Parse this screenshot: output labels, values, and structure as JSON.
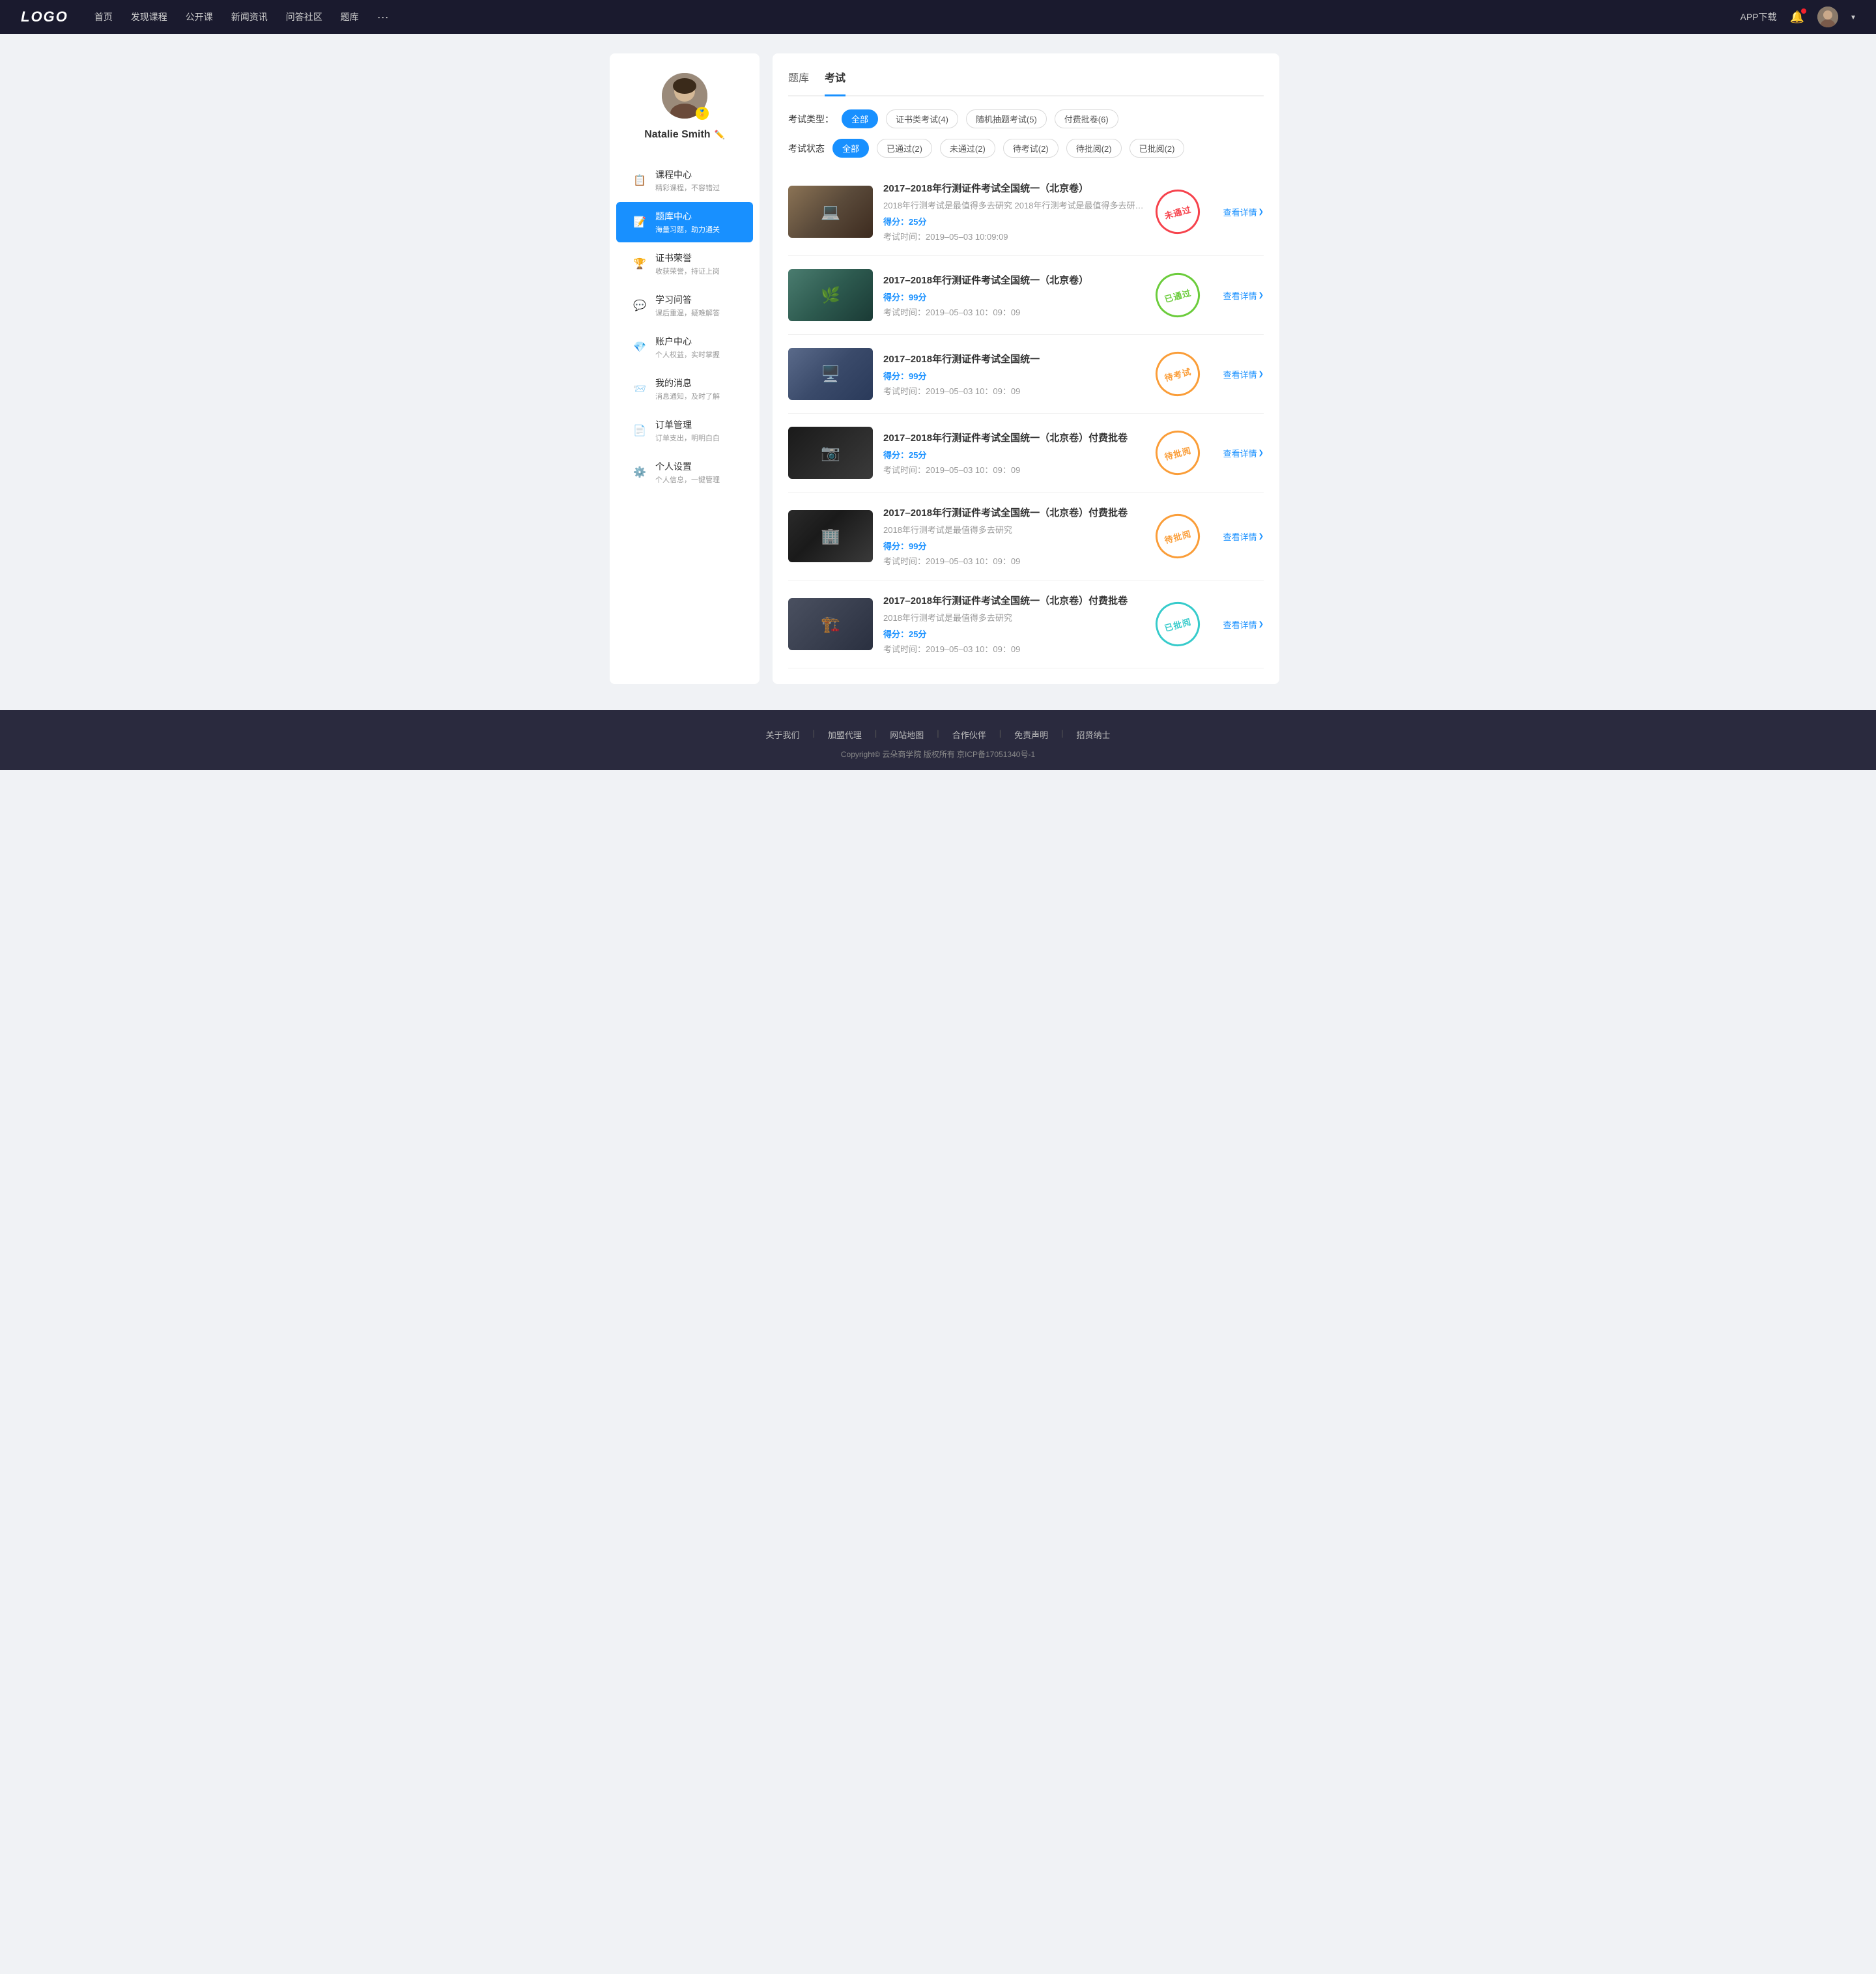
{
  "navbar": {
    "logo": "LOGO",
    "links": [
      "首页",
      "发现课程",
      "公开课",
      "新闻资讯",
      "问答社区",
      "题库"
    ],
    "more": "···",
    "app_download": "APP下载",
    "user_name": "Natalie Smith"
  },
  "sidebar": {
    "profile": {
      "name": "Natalie Smith",
      "badge": "🏅"
    },
    "menu": [
      {
        "id": "course-center",
        "icon": "📋",
        "label": "课程中心",
        "sub": "精彩课程，不容错过",
        "active": false
      },
      {
        "id": "question-bank",
        "icon": "📝",
        "label": "题库中心",
        "sub": "海量习题，助力通关",
        "active": true
      },
      {
        "id": "certificates",
        "icon": "🏆",
        "label": "证书荣誉",
        "sub": "收获荣誉，持证上岗",
        "active": false
      },
      {
        "id": "qa",
        "icon": "💬",
        "label": "学习问答",
        "sub": "课后重温，疑难解答",
        "active": false
      },
      {
        "id": "account",
        "icon": "💎",
        "label": "账户中心",
        "sub": "个人权益，实时掌握",
        "active": false
      },
      {
        "id": "messages",
        "icon": "📨",
        "label": "我的消息",
        "sub": "消息通知，及时了解",
        "active": false
      },
      {
        "id": "orders",
        "icon": "📄",
        "label": "订单管理",
        "sub": "订单支出，明明白白",
        "active": false
      },
      {
        "id": "settings",
        "icon": "⚙️",
        "label": "个人设置",
        "sub": "个人信息，一键管理",
        "active": false
      }
    ]
  },
  "content": {
    "tabs": [
      {
        "id": "question-bank-tab",
        "label": "题库",
        "active": false
      },
      {
        "id": "exam-tab",
        "label": "考试",
        "active": true
      }
    ],
    "filter_type": {
      "label": "考试类型：",
      "options": [
        {
          "label": "全部",
          "active": true
        },
        {
          "label": "证书类考试(4)",
          "active": false
        },
        {
          "label": "随机抽题考试(5)",
          "active": false
        },
        {
          "label": "付费批卷(6)",
          "active": false
        }
      ]
    },
    "filter_status": {
      "label": "考试状态",
      "options": [
        {
          "label": "全部",
          "active": true
        },
        {
          "label": "已通过(2)",
          "active": false
        },
        {
          "label": "未通过(2)",
          "active": false
        },
        {
          "label": "待考试(2)",
          "active": false
        },
        {
          "label": "待批阅(2)",
          "active": false
        },
        {
          "label": "已批阅(2)",
          "active": false
        }
      ]
    },
    "exams": [
      {
        "id": "exam-1",
        "title": "2017–2018年行测证件考试全国统一（北京卷）",
        "desc": "2018年行测考试是最值得多去研究 2018年行测考试是最值得多去研究 2018年行...",
        "score_label": "得分：",
        "score": "25",
        "score_unit": "分",
        "time_label": "考试时间：",
        "time": "2019–05–03  10:09:09",
        "status": "未通过",
        "status_type": "red",
        "thumb_class": "thumb-1",
        "detail_label": "查看详情"
      },
      {
        "id": "exam-2",
        "title": "2017–2018年行测证件考试全国统一（北京卷）",
        "desc": "",
        "score_label": "得分：",
        "score": "99",
        "score_unit": "分",
        "time_label": "考试时间：",
        "time": "2019–05–03  10：09：09",
        "status": "已通过",
        "status_type": "green",
        "thumb_class": "thumb-2",
        "detail_label": "查看详情"
      },
      {
        "id": "exam-3",
        "title": "2017–2018年行测证件考试全国统一",
        "desc": "",
        "score_label": "得分：",
        "score": "99",
        "score_unit": "分",
        "time_label": "考试时间：",
        "time": "2019–05–03  10：09：09",
        "status": "待考试",
        "status_type": "orange",
        "thumb_class": "thumb-3",
        "detail_label": "查看详情"
      },
      {
        "id": "exam-4",
        "title": "2017–2018年行测证件考试全国统一（北京卷）付费批卷",
        "desc": "",
        "score_label": "得分：",
        "score": "25",
        "score_unit": "分",
        "time_label": "考试时间：",
        "time": "2019–05–03  10：09：09",
        "status": "待批阅",
        "status_type": "orange",
        "thumb_class": "thumb-4",
        "detail_label": "查看详情"
      },
      {
        "id": "exam-5",
        "title": "2017–2018年行测证件考试全国统一（北京卷）付费批卷",
        "desc": "2018年行测考试是最值得多去研究",
        "score_label": "得分：",
        "score": "99",
        "score_unit": "分",
        "time_label": "考试时间：",
        "time": "2019–05–03  10：09：09",
        "status": "待批阅",
        "status_type": "orange",
        "thumb_class": "thumb-5",
        "detail_label": "查看详情"
      },
      {
        "id": "exam-6",
        "title": "2017–2018年行测证件考试全国统一（北京卷）付费批卷",
        "desc": "2018年行测考试是最值得多去研究",
        "score_label": "得分：",
        "score": "25",
        "score_unit": "分",
        "time_label": "考试时间：",
        "time": "2019–05–03  10：09：09",
        "status": "已批阅",
        "status_type": "teal",
        "thumb_class": "thumb-6",
        "detail_label": "查看详情"
      }
    ]
  },
  "footer": {
    "links": [
      "关于我们",
      "加盟代理",
      "网站地图",
      "合作伙伴",
      "免责声明",
      "招贤纳士"
    ],
    "copyright": "Copyright© 云朵商学院  版权所有    京ICP备17051340号-1"
  }
}
